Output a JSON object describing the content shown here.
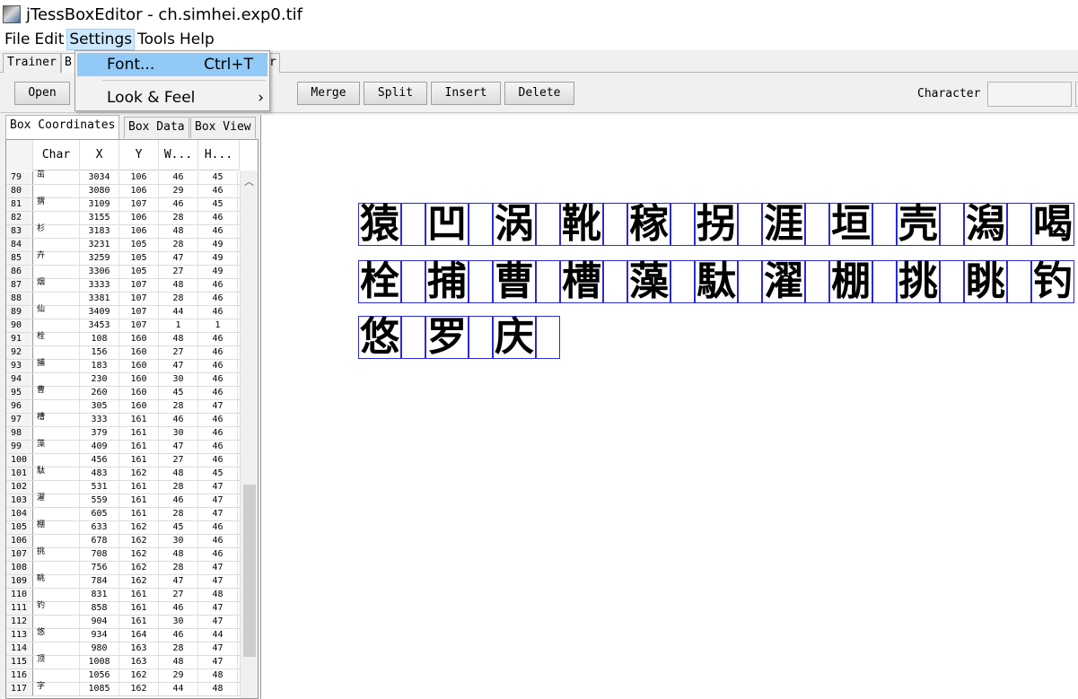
{
  "window": {
    "title": "jTessBoxEditor - ch.simhei.exp0.tif"
  },
  "menu": [
    "File",
    "Edit",
    "Settings",
    "Tools",
    "Help"
  ],
  "top_tabs": [
    "Trainer",
    "B",
    "r"
  ],
  "dropdown": {
    "items": [
      {
        "label": "Font...",
        "accel": "Ctrl+T"
      },
      {
        "label": "Look & Feel",
        "accel": "›"
      }
    ]
  },
  "toolbar": {
    "open": "Open",
    "merge": "Merge",
    "split": "Split",
    "insert": "Insert",
    "delete": "Delete",
    "character_label": "Character"
  },
  "subtabs": [
    "Box Coordinates",
    "Box Data",
    "Box View"
  ],
  "table": {
    "headers": [
      "Char",
      "X",
      "Y",
      "W...",
      "H..."
    ],
    "rows": [
      [
        "79",
        "茁",
        "3034",
        "106",
        "46",
        "45"
      ],
      [
        "80",
        "",
        "3080",
        "106",
        "29",
        "46"
      ],
      [
        "81",
        "猬",
        "3109",
        "107",
        "46",
        "45"
      ],
      [
        "82",
        "",
        "3155",
        "106",
        "28",
        "46"
      ],
      [
        "83",
        "杉",
        "3183",
        "106",
        "48",
        "46"
      ],
      [
        "84",
        "",
        "3231",
        "105",
        "28",
        "49"
      ],
      [
        "85",
        "卉",
        "3259",
        "105",
        "47",
        "49"
      ],
      [
        "86",
        "",
        "3306",
        "105",
        "27",
        "49"
      ],
      [
        "87",
        "烟",
        "3333",
        "107",
        "48",
        "46"
      ],
      [
        "88",
        "",
        "3381",
        "107",
        "28",
        "46"
      ],
      [
        "89",
        "仙",
        "3409",
        "107",
        "44",
        "46"
      ],
      [
        "90",
        "",
        "3453",
        "107",
        "1",
        "1"
      ],
      [
        "91",
        "栓",
        "108",
        "160",
        "48",
        "46"
      ],
      [
        "92",
        "",
        "156",
        "160",
        "27",
        "46"
      ],
      [
        "93",
        "捕",
        "183",
        "160",
        "47",
        "46"
      ],
      [
        "94",
        "",
        "230",
        "160",
        "30",
        "46"
      ],
      [
        "95",
        "曹",
        "260",
        "160",
        "45",
        "46"
      ],
      [
        "96",
        "",
        "305",
        "160",
        "28",
        "47"
      ],
      [
        "97",
        "槽",
        "333",
        "161",
        "46",
        "46"
      ],
      [
        "98",
        "",
        "379",
        "161",
        "30",
        "46"
      ],
      [
        "99",
        "藻",
        "409",
        "161",
        "47",
        "46"
      ],
      [
        "100",
        "",
        "456",
        "161",
        "27",
        "46"
      ],
      [
        "101",
        "駄",
        "483",
        "162",
        "48",
        "45"
      ],
      [
        "102",
        "",
        "531",
        "161",
        "28",
        "47"
      ],
      [
        "103",
        "濯",
        "559",
        "161",
        "46",
        "47"
      ],
      [
        "104",
        "",
        "605",
        "161",
        "28",
        "47"
      ],
      [
        "105",
        "棚",
        "633",
        "162",
        "45",
        "46"
      ],
      [
        "106",
        "",
        "678",
        "162",
        "30",
        "46"
      ],
      [
        "107",
        "挑",
        "708",
        "162",
        "48",
        "46"
      ],
      [
        "108",
        "",
        "756",
        "162",
        "28",
        "47"
      ],
      [
        "109",
        "眺",
        "784",
        "162",
        "47",
        "47"
      ],
      [
        "110",
        "",
        "831",
        "161",
        "27",
        "48"
      ],
      [
        "111",
        "钓",
        "858",
        "161",
        "46",
        "47"
      ],
      [
        "112",
        "",
        "904",
        "161",
        "30",
        "47"
      ],
      [
        "113",
        "悠",
        "934",
        "164",
        "46",
        "44"
      ],
      [
        "114",
        "",
        "980",
        "163",
        "28",
        "47"
      ],
      [
        "115",
        "顶",
        "1008",
        "163",
        "48",
        "47"
      ],
      [
        "116",
        "",
        "1056",
        "162",
        "29",
        "48"
      ],
      [
        "117",
        "字",
        "1085",
        "162",
        "44",
        "48"
      ]
    ]
  },
  "image_text": {
    "line1": [
      "猿",
      "凹",
      "涡",
      "靴",
      "稼",
      "拐",
      "涯",
      "垣",
      "壳",
      "潟",
      "喝"
    ],
    "line2": [
      "栓",
      "捕",
      "曹",
      "槽",
      "藻",
      "駄",
      "濯",
      "棚",
      "挑",
      "眺",
      "钓"
    ],
    "line3": [
      "悠",
      "罗",
      "庆"
    ]
  }
}
